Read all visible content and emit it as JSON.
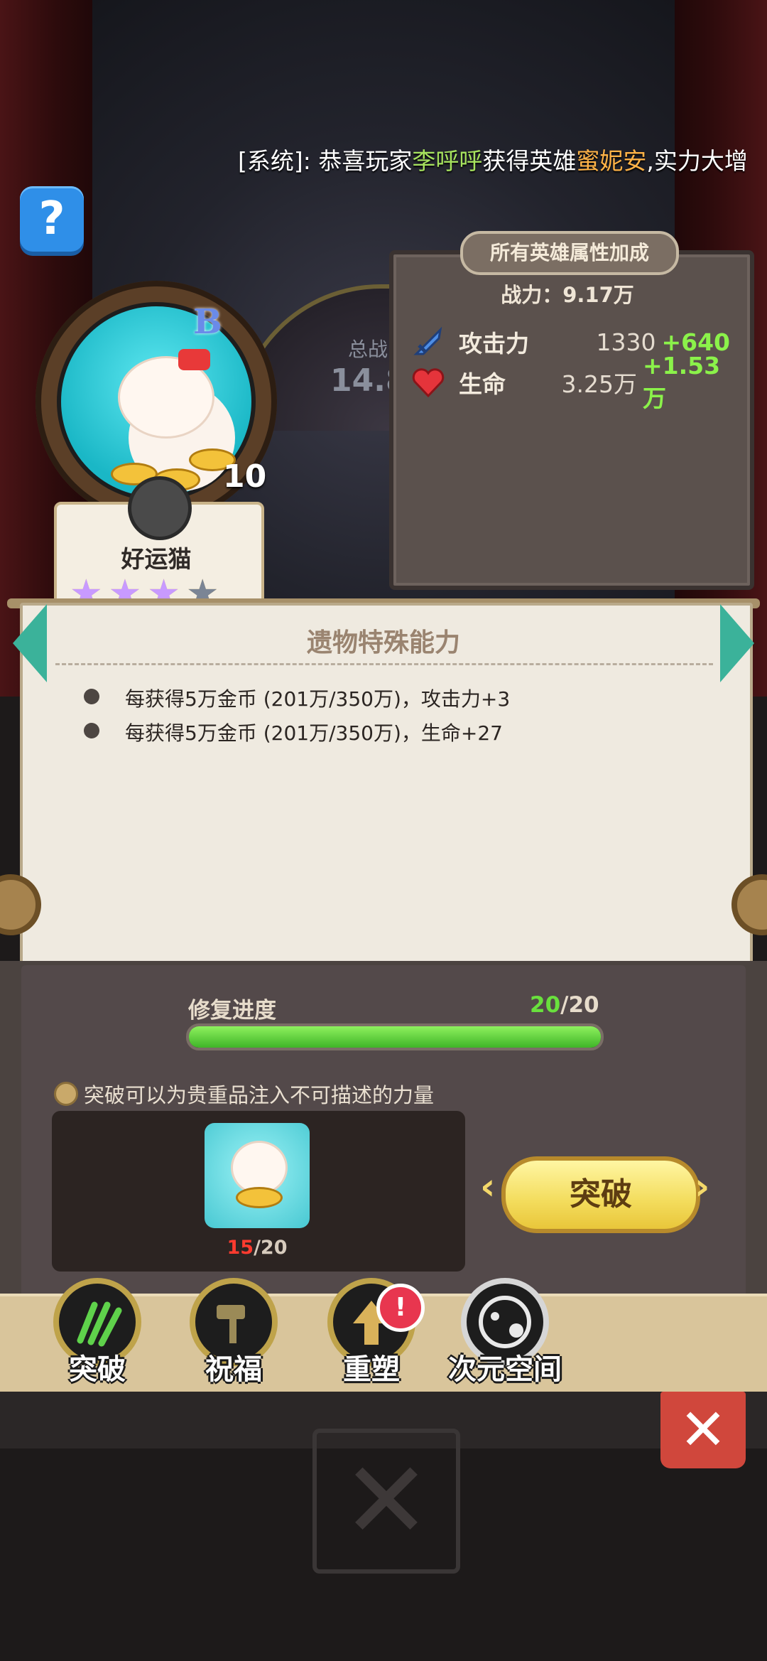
{
  "system_message": {
    "prefix": "[系统]: 恭喜玩家",
    "player": "李呼呼",
    "mid": "获得英雄",
    "hero": "蜜妮安",
    "suffix": ",实力大增"
  },
  "help": {
    "label": "?"
  },
  "background": {
    "total_label": "总战",
    "total_value": "14.8"
  },
  "hero": {
    "rank": "B",
    "level": "10",
    "name": "好运猫",
    "stars_total": 4,
    "stars_filled": 3
  },
  "bonus_panel": {
    "title": "所有英雄属性加成",
    "power": "战力：9.17万",
    "rows": [
      {
        "icon": "sword-icon",
        "label": "攻击力",
        "value": "1330",
        "bonus": "+640"
      },
      {
        "icon": "heart-icon",
        "label": "生命",
        "value": "3.25万",
        "bonus": "+1.53万"
      }
    ]
  },
  "relic": {
    "title": "遗物特殊能力",
    "abilities": [
      "每获得5万金币 (201万/350万)，攻击力+3",
      "每获得5万金币 (201万/350万)，生命+27"
    ]
  },
  "restore": {
    "label": "修复进度",
    "current": "20",
    "total": "/20",
    "progress_fraction": 1.0
  },
  "breakthrough": {
    "tip": "突破可以为贵重品注入不可描述的力量",
    "material_have": "15",
    "material_need": "/20",
    "button_label": "突破"
  },
  "tabs": [
    {
      "label": "突破",
      "icon": "claw-icon"
    },
    {
      "label": "祝福",
      "icon": "hammer-icon"
    },
    {
      "label": "重塑",
      "icon": "upgrade-arrow-icon",
      "badge": "!"
    },
    {
      "label": "次元空间",
      "icon": "portal-icon"
    }
  ],
  "colors": {
    "bonus_green": "#8bf24a",
    "progress_green": "#3fb528",
    "shortage_red": "#ff3b2f",
    "button_yellow": "#f3dc5c",
    "close_red": "#d0473c"
  }
}
